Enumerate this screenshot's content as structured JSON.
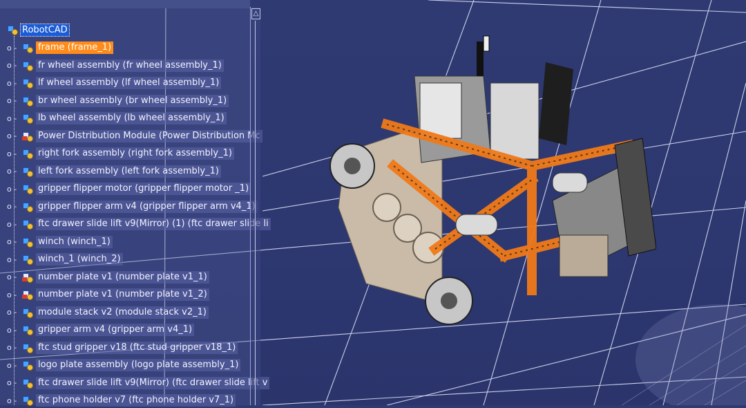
{
  "tree": {
    "root_label": "RobotCAD",
    "items": [
      {
        "label": "frame (frame_1)",
        "selected": true,
        "icon": "product-icon"
      },
      {
        "label": "fr wheel assembly (fr wheel assembly_1)",
        "icon": "product-icon"
      },
      {
        "label": "lf wheel assembly (lf wheel assembly_1)",
        "icon": "product-icon"
      },
      {
        "label": "br wheel assembly (br wheel assembly_1)",
        "icon": "product-icon"
      },
      {
        "label": "lb wheel assembly (lb wheel assembly_1)",
        "icon": "product-icon"
      },
      {
        "label": "Power Distribution Module (Power Distribution Mc",
        "icon": "part-icon"
      },
      {
        "label": "right fork assembly (right fork assembly_1)",
        "icon": "product-icon"
      },
      {
        "label": "left fork assembly (left fork assembly_1)",
        "icon": "product-icon"
      },
      {
        "label": "gripper flipper motor  (gripper flipper motor _1)",
        "icon": "product-icon"
      },
      {
        "label": "gripper flipper arm v4 (gripper flipper arm v4_1)",
        "icon": "product-icon"
      },
      {
        "label": "ftc drawer slide lift v9(Mirror) (1) (ftc drawer slide li",
        "icon": "product-icon"
      },
      {
        "label": "winch (winch_1)",
        "icon": "product-icon"
      },
      {
        "label": "winch_1 (winch_2)",
        "icon": "product-icon"
      },
      {
        "label": "number plate v1 (number plate v1_1)",
        "icon": "part-icon"
      },
      {
        "label": "number plate v1 (number plate v1_2)",
        "icon": "part-icon"
      },
      {
        "label": "module stack v2 (module stack v2_1)",
        "icon": "product-icon"
      },
      {
        "label": "gripper arm v4 (gripper arm v4_1)",
        "icon": "product-icon"
      },
      {
        "label": "ftc stud gripper v18 (ftc stud gripper v18_1)",
        "icon": "product-icon"
      },
      {
        "label": "logo plate assembly (logo plate assembly_1)",
        "icon": "product-icon"
      },
      {
        "label": "ftc drawer slide lift v9(Mirror) (ftc drawer slide lift v",
        "icon": "product-icon"
      },
      {
        "label": "ftc phone holder v7 (ftc phone holder v7_1)",
        "icon": "product-icon"
      }
    ],
    "connector": "o -"
  },
  "scrollbar": {
    "up_arrow": "△"
  },
  "colors": {
    "background": "#2d3770",
    "selection": "#ff8c1a",
    "root_selection": "#1a5bd6",
    "frame_orange": "#f07a1a"
  }
}
